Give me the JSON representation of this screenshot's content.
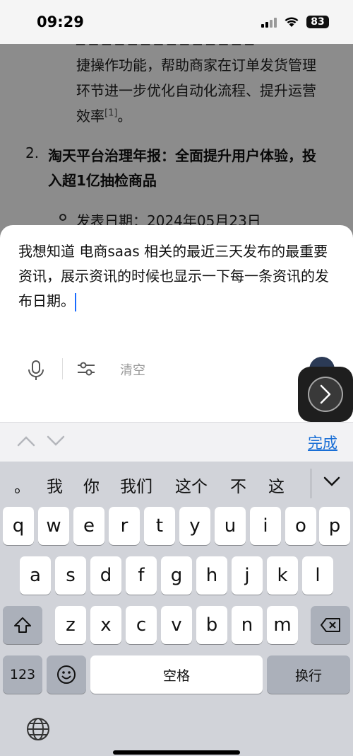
{
  "status_bar": {
    "time": "09:29",
    "battery": "83"
  },
  "article": {
    "line_1": "捷操作功能，帮助商家在订单发货管理",
    "line_2": "环节进一步优化自动化流程、提升运营",
    "line_3": "效率",
    "cite_1": "[1]",
    "line_3_end": "。",
    "item_number": "2.",
    "item_title_1": "淘天平台治理年报：全面提升用户体验，投",
    "item_title_2": "入超1亿抽检商品",
    "date_line": "发表日期：2024年05月23日"
  },
  "input": {
    "query": "我想知道 电商saas 相关的最近三天发布的最重要资讯，展示资讯的时候也显示一下每一条资讯的发布日期。",
    "clear_label": "清空"
  },
  "accessory": {
    "done_label": "完成"
  },
  "keyboard": {
    "candidates": [
      "。",
      "我",
      "你",
      "我们",
      "这个",
      "不",
      "这"
    ],
    "row1": [
      "q",
      "w",
      "e",
      "r",
      "t",
      "y",
      "u",
      "i",
      "o",
      "p"
    ],
    "row2": [
      "a",
      "s",
      "d",
      "f",
      "g",
      "h",
      "j",
      "k",
      "l"
    ],
    "row3": [
      "z",
      "x",
      "c",
      "v",
      "b",
      "n",
      "m"
    ],
    "numbers_label": "123",
    "space_label": "空格",
    "return_label": "换行"
  },
  "colors": {
    "accent": "#1a6fd6",
    "caret": "#1a6bff",
    "keyboard_bg": "#d1d3d9"
  }
}
